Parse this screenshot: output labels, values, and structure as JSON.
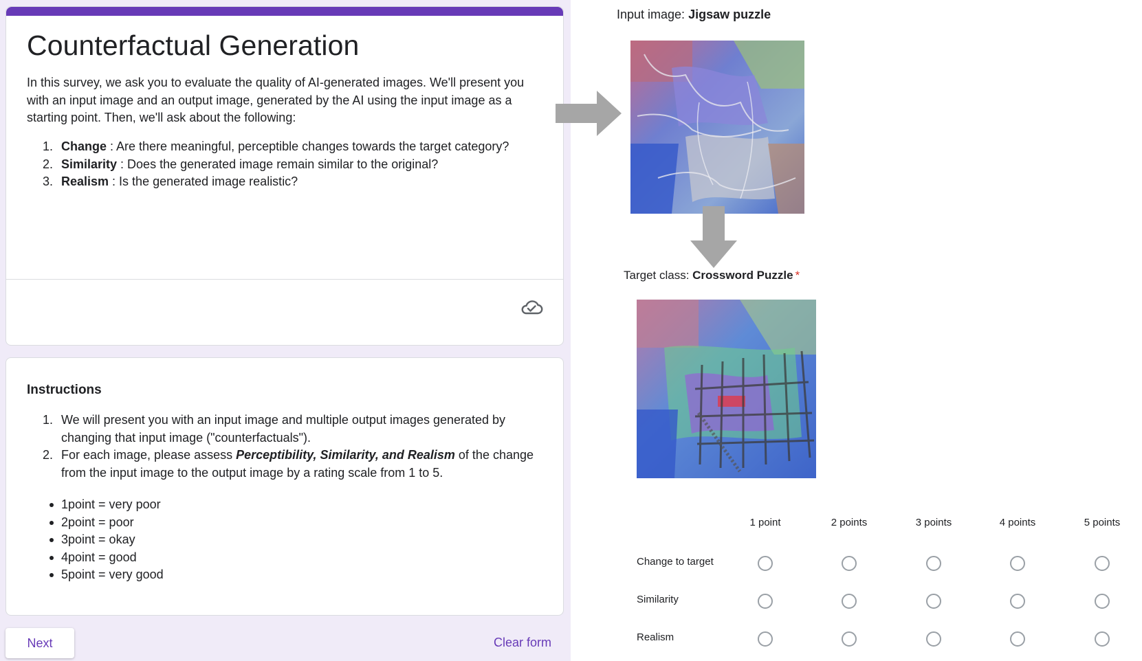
{
  "form": {
    "title": "Counterfactual Generation",
    "intro": "In this survey, we ask you to evaluate the quality of AI-generated images. We'll present you with an input image and an output image, generated by the AI using the input image as a starting point. Then, we'll ask about the following:",
    "criteria": [
      {
        "num": "1.",
        "term": "Change",
        "text": " : Are there meaningful, perceptible changes towards the target category?"
      },
      {
        "num": "2.",
        "term": "Similarity",
        "text": " : Does the generated image remain similar to the original?"
      },
      {
        "num": "3.",
        "term": "Realism",
        "text": " : Is the generated image realistic?"
      }
    ],
    "accent_color": "#673ab7",
    "background_color": "#f0ebf8",
    "saved_icon": "cloud-check-icon"
  },
  "instructions": {
    "title": "Instructions",
    "step1_num": "1.",
    "step1_text": "We will present you with an input image and multiple output images generated by changing that input image (\"counterfactuals\").",
    "step2_num": "2.",
    "step2_before": "For each image, please assess ",
    "step2_emph": "Perceptibility, Similarity, and Realism",
    "step2_after": " of the change from the input image to the output image by a rating scale from 1 to 5.",
    "points": [
      "1point = very poor",
      "2point = poor",
      "3point = okay",
      "4point = good",
      "5point = very good"
    ]
  },
  "footer": {
    "next_label": "Next",
    "clear_label": "Clear form"
  },
  "question": {
    "input_prefix": "Input image: ",
    "input_class": "Jigsaw puzzle",
    "target_prefix": "Target class: ",
    "target_class": "Crossword Puzzle",
    "required_mark": "*",
    "columns": [
      "1 point",
      "2 points",
      "3 points",
      "4 points",
      "5 points"
    ],
    "rows": [
      "Change to target",
      "Similarity",
      "Realism"
    ]
  }
}
